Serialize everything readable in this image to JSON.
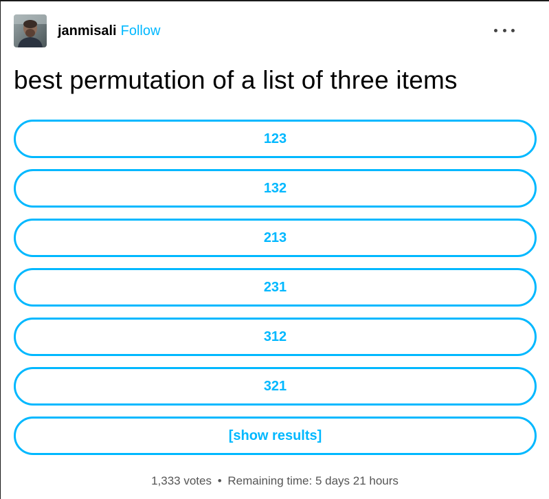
{
  "post": {
    "author": "janmisali",
    "follow_label": "Follow",
    "question": "best permutation of a list of three items"
  },
  "poll": {
    "options": [
      "123",
      "132",
      "213",
      "231",
      "312",
      "321"
    ],
    "show_results_label": "[show results]",
    "votes": "1,333 votes",
    "separator": "•",
    "remaining": "Remaining time: 5 days 21 hours"
  },
  "colors": {
    "accent": "#00b8ff",
    "text": "#000000",
    "muted": "#555555"
  },
  "icons": {
    "more": "more-horizontal-icon",
    "avatar": "avatar"
  }
}
